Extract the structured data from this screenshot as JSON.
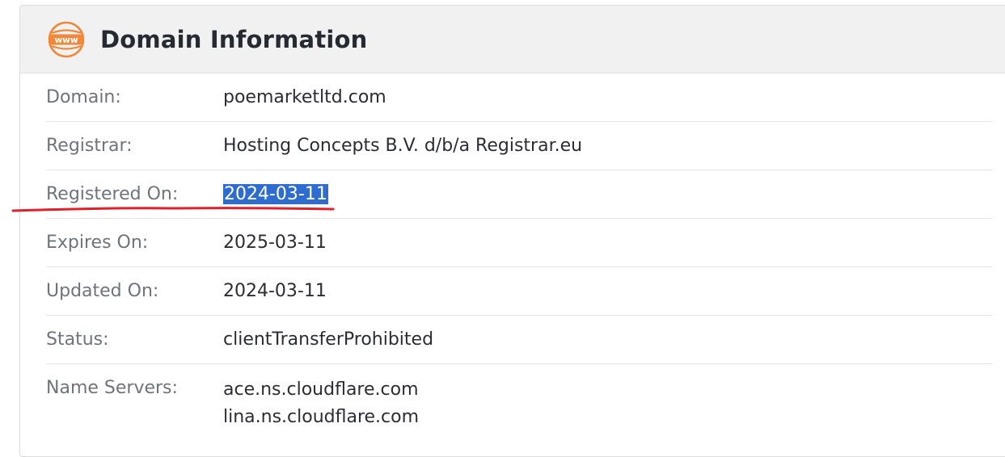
{
  "panel": {
    "title": "Domain Information",
    "icon": "www-globe-icon",
    "accent_color": "#f0883c"
  },
  "rows": [
    {
      "label": "Domain:",
      "value": "poemarketltd.com"
    },
    {
      "label": "Registrar:",
      "value": "Hosting Concepts B.V. d/b/a Registrar.eu"
    },
    {
      "label": "Registered On:",
      "value": "2024-03-11",
      "selected": true
    },
    {
      "label": "Expires On:",
      "value": "2025-03-11"
    },
    {
      "label": "Updated On:",
      "value": "2024-03-11"
    },
    {
      "label": "Status:",
      "value": "clientTransferProhibited"
    },
    {
      "label": "Name Servers:",
      "values": [
        "ace.ns.cloudflare.com",
        "lina.ns.cloudflare.com"
      ]
    }
  ],
  "annotation": {
    "type": "red-underline",
    "color": "#e0202a",
    "target_row": "Registered On:"
  }
}
